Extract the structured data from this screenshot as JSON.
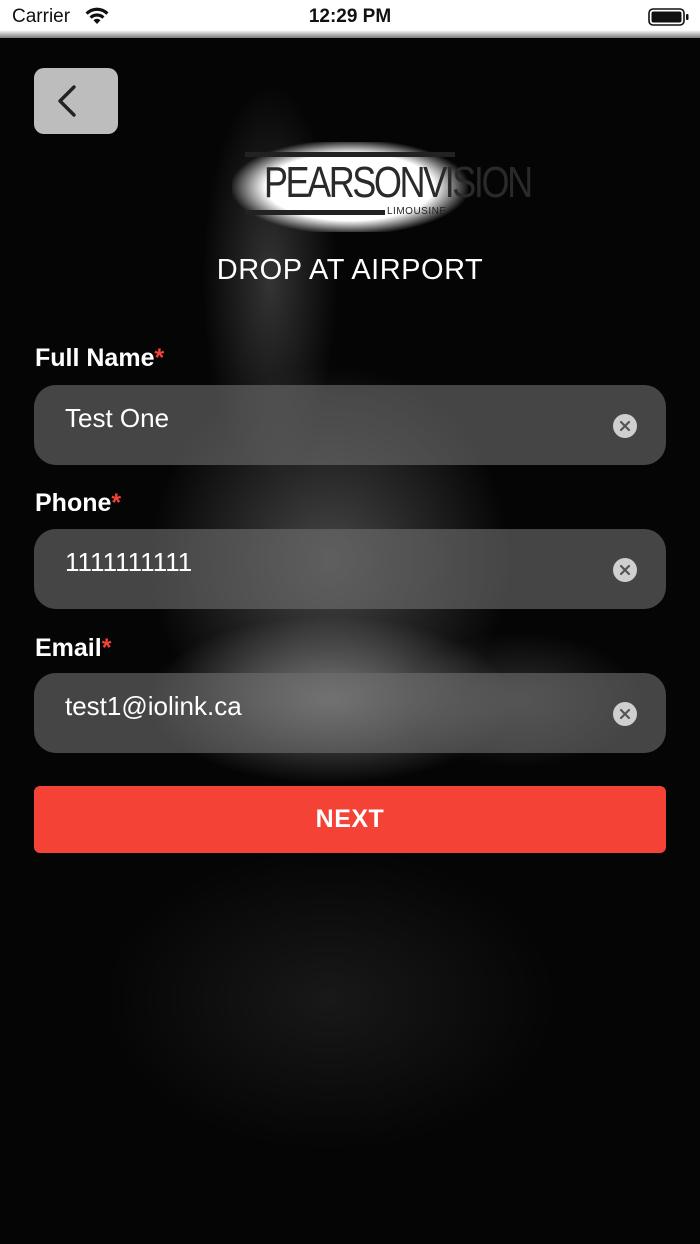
{
  "status_bar": {
    "carrier": "Carrier",
    "time": "12:29 PM",
    "icons": [
      "wifi-icon",
      "battery-icon"
    ]
  },
  "header": {
    "back_icon": "chevron-left-icon",
    "logo_word_bold": "PEARSON",
    "logo_word_thin": "VISION",
    "logo_sub": "LIMOUSINE"
  },
  "title": "DROP AT AIRPORT",
  "form": {
    "required_mark": "*",
    "full_name": {
      "label": "Full Name",
      "value": "Test One"
    },
    "phone": {
      "label": "Phone",
      "value": "1111111111"
    },
    "email": {
      "label": "Email",
      "value": "test1@iolink.ca"
    },
    "clear_icon": "clear-circle-icon"
  },
  "next_button": {
    "label": "NEXT"
  },
  "colors": {
    "accent": "#f44336",
    "field_background": "#6e6e6e",
    "back_button": "#bdbdbd"
  }
}
